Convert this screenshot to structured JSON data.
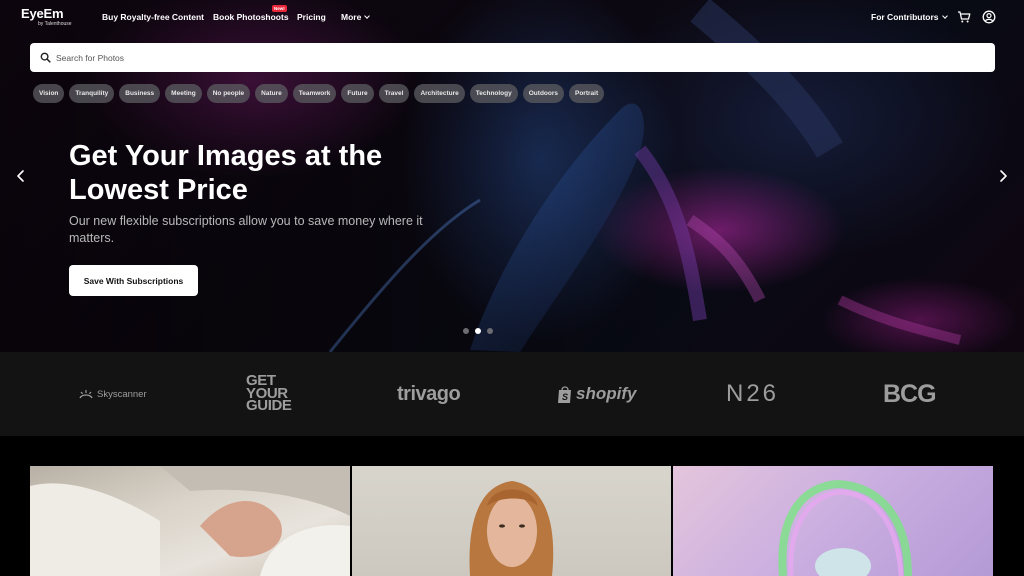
{
  "nav": {
    "logo": "EyeEm",
    "logo_sub": "by Talenthouse",
    "links": [
      "Buy Royalty-free Content",
      "Book Photoshoots",
      "Pricing",
      "More"
    ],
    "new_badge": "New!",
    "contributors": "For Contributors",
    "icons": [
      "cart-icon",
      "account-icon"
    ]
  },
  "search": {
    "placeholder": "Search for Photos"
  },
  "chips": [
    "Vision",
    "Tranquility",
    "Business",
    "Meeting",
    "No people",
    "Nature",
    "Teamwork",
    "Future",
    "Travel",
    "Architecture",
    "Technology",
    "Outdoors",
    "Portrait"
  ],
  "hero": {
    "title": "Get Your Images at the Lowest Price",
    "subtitle": "Our new flexible subscriptions allow you to save money where it matters.",
    "cta": "Save With Subscriptions",
    "slides": 3,
    "active_slide": 2
  },
  "clients": {
    "skyscanner": "Skyscanner",
    "gyg": [
      "GET",
      "YOUR",
      "GUIDE"
    ],
    "trivago": "trivago",
    "shopify": "shopify",
    "n26": "N26",
    "bcg": "BCG"
  },
  "colors": {
    "badge": "#e8283a",
    "client_bar": "#131313",
    "logo_gray": "#9d9d9d"
  }
}
